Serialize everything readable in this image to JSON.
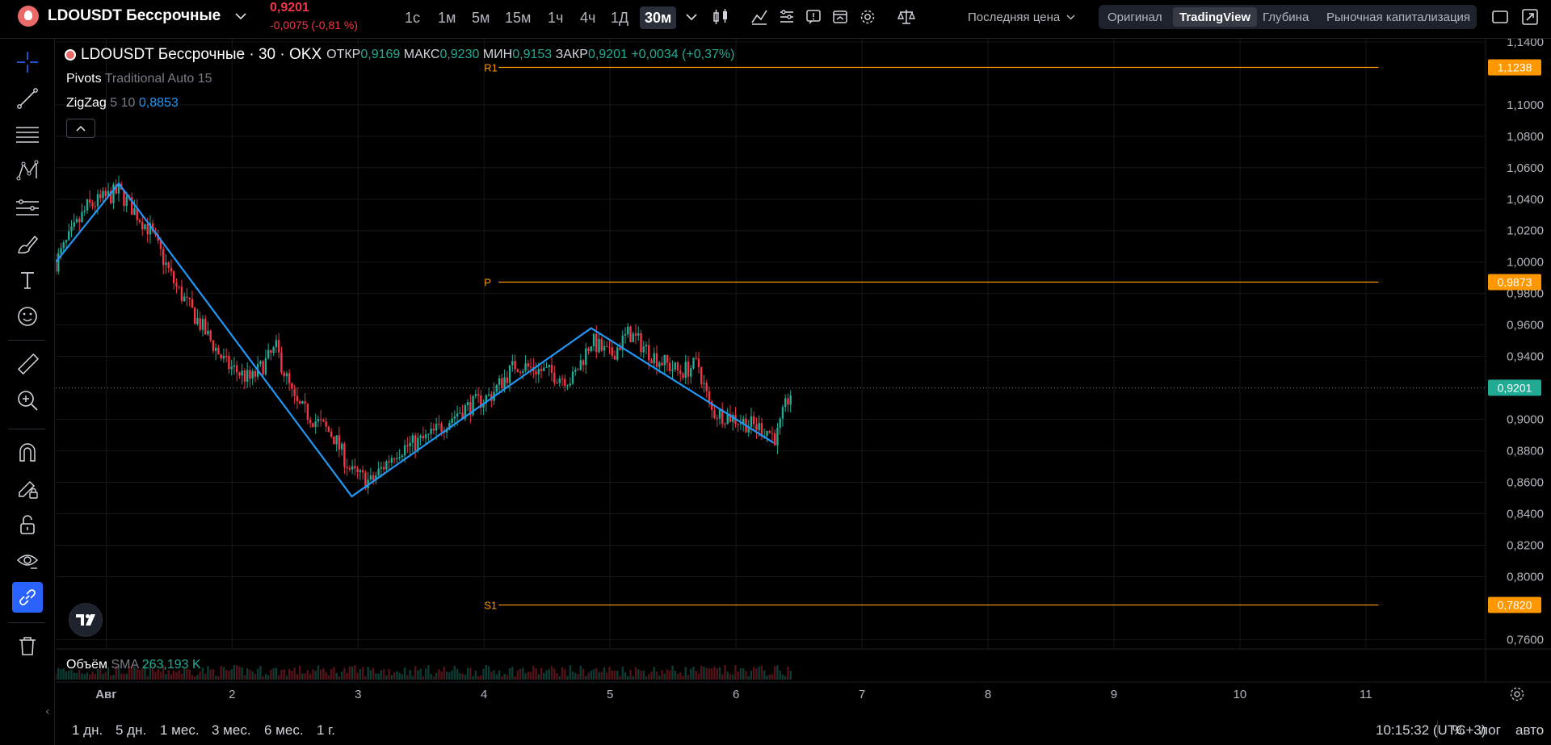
{
  "header": {
    "symbol_name": "LDOUSDT Бессрочные",
    "last_price": "0,9201",
    "last_change": "-0,0075 (-0,81 %)",
    "intervals": [
      "1с",
      "1м",
      "5м",
      "15м",
      "1ч",
      "4ч",
      "1Д",
      "30м"
    ],
    "active_interval": "30м",
    "price_type": "Последняя цена",
    "views": [
      "Оригинал",
      "TradingView",
      "Глубина",
      "Рыночная капитализация"
    ],
    "active_view": "TradingView"
  },
  "legend": {
    "title": "LDOUSDT Бессрочные · 30 · OKX",
    "open_label": "ОТКР",
    "open": "0,9169",
    "high_label": "МАКС",
    "high": "0,9230",
    "low_label": "МИН",
    "low": "0,9153",
    "close_label": "ЗАКР",
    "close": "0,9201",
    "change": "+0,0034 (+0,37%)",
    "pivots_name": "Pivots",
    "pivots_params": "Traditional Auto 15",
    "zigzag_name": "ZigZag",
    "zigzag_params": "5 10",
    "zigzag_value": "0,8853"
  },
  "volume": {
    "name": "Объём",
    "ma": "SMA",
    "value": "263,193 K"
  },
  "bottom": {
    "ranges": [
      "1 дн.",
      "5 дн.",
      "1 мес.",
      "3 мес.",
      "6 мес.",
      "1 г."
    ],
    "clock": "10:15:32 (UTC+3)",
    "percent": "%",
    "log": "лог",
    "auto": "авто"
  },
  "colors": {
    "up": "#22ab94",
    "down": "#f23645",
    "zigzag": "#2196f3",
    "pivot": "#ff9800",
    "last_price_bg": "#22ab94"
  },
  "chart_data": {
    "type": "candlestick",
    "interval": "30m",
    "y_tick_labels": [
      "1,1400",
      "1,1000",
      "1,0800",
      "1,0600",
      "1,0400",
      "1,0200",
      "1,0000",
      "0,9800",
      "0,9600",
      "0,9400",
      "0,9000",
      "0,8800",
      "0,8600",
      "0,8400",
      "0,8200",
      "0,8000",
      "0,7600"
    ],
    "ylim": [
      0.752,
      1.142
    ],
    "x_tick_labels": [
      "Авг",
      "2",
      "3",
      "4",
      "5",
      "6",
      "7",
      "8",
      "9",
      "10",
      "11"
    ],
    "xlim": [
      0.6,
      11.95
    ],
    "price_close": 0.9201,
    "price_tags": [
      {
        "label": "R1",
        "value": 1.1238,
        "text": "1,1238"
      },
      {
        "label": "P",
        "value": 0.9873,
        "text": "0,9873"
      },
      {
        "label": "S1",
        "value": 0.782,
        "text": "0,7820"
      }
    ],
    "last_price_tag": "0,9201",
    "zigzag": [
      {
        "x": 0.6,
        "y": 1.0
      },
      {
        "x": 1.1,
        "y": 1.05
      },
      {
        "x": 2.95,
        "y": 0.851
      },
      {
        "x": 4.85,
        "y": 0.958
      },
      {
        "x": 6.3,
        "y": 0.885
      }
    ],
    "price_path": [
      {
        "x": 0.6,
        "y": 1.0
      },
      {
        "x": 0.85,
        "y": 1.035
      },
      {
        "x": 1.1,
        "y": 1.045
      },
      {
        "x": 1.35,
        "y": 1.02
      },
      {
        "x": 1.55,
        "y": 0.985
      },
      {
        "x": 1.75,
        "y": 0.96
      },
      {
        "x": 1.95,
        "y": 0.935
      },
      {
        "x": 2.15,
        "y": 0.925
      },
      {
        "x": 2.35,
        "y": 0.945
      },
      {
        "x": 2.5,
        "y": 0.91
      },
      {
        "x": 2.65,
        "y": 0.9
      },
      {
        "x": 2.8,
        "y": 0.89
      },
      {
        "x": 2.95,
        "y": 0.866
      },
      {
        "x": 3.1,
        "y": 0.86
      },
      {
        "x": 3.3,
        "y": 0.88
      },
      {
        "x": 3.55,
        "y": 0.888
      },
      {
        "x": 3.8,
        "y": 0.905
      },
      {
        "x": 4.05,
        "y": 0.915
      },
      {
        "x": 4.25,
        "y": 0.935
      },
      {
        "x": 4.5,
        "y": 0.93
      },
      {
        "x": 4.7,
        "y": 0.925
      },
      {
        "x": 4.85,
        "y": 0.95
      },
      {
        "x": 5.0,
        "y": 0.94
      },
      {
        "x": 5.15,
        "y": 0.955
      },
      {
        "x": 5.35,
        "y": 0.94
      },
      {
        "x": 5.55,
        "y": 0.93
      },
      {
        "x": 5.7,
        "y": 0.935
      },
      {
        "x": 5.8,
        "y": 0.905
      },
      {
        "x": 5.95,
        "y": 0.902
      },
      {
        "x": 6.1,
        "y": 0.897
      },
      {
        "x": 6.25,
        "y": 0.893
      },
      {
        "x": 6.32,
        "y": 0.888
      },
      {
        "x": 6.4,
        "y": 0.91
      },
      {
        "x": 6.45,
        "y": 0.9201
      }
    ]
  }
}
